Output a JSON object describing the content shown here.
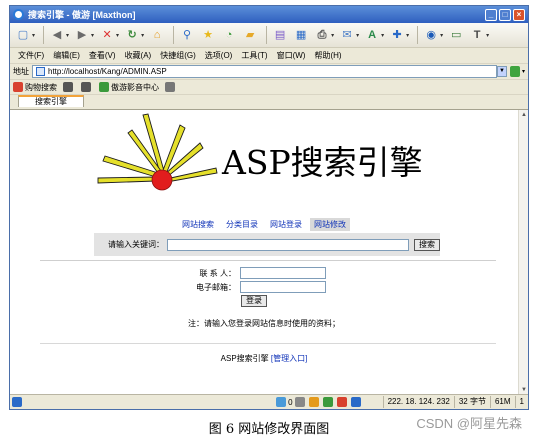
{
  "window": {
    "title": "搜索引擎 - 傲游 [Maxthon]",
    "buttons": {
      "minimize": "_",
      "maximize": "□",
      "close": "×"
    }
  },
  "toolbar": {
    "buttons": [
      {
        "icon": "new-page-icon",
        "glyph": "▢",
        "color": "#4a7ec8"
      },
      {
        "icon": "back-icon",
        "glyph": "◀",
        "color": "#6b6b6b"
      },
      {
        "icon": "forward-icon",
        "glyph": "▶",
        "color": "#6b6b6b"
      },
      {
        "icon": "stop-icon",
        "glyph": "✕",
        "color": "#d33"
      },
      {
        "icon": "refresh-icon",
        "glyph": "↻",
        "color": "#3b8a3b"
      },
      {
        "icon": "home-icon",
        "glyph": "⌂",
        "color": "#e49a1c"
      },
      {
        "icon": "search-icon",
        "glyph": "⚲",
        "color": "#2a6ac8"
      },
      {
        "icon": "favorites-star-icon",
        "glyph": "★",
        "color": "#e8b81a"
      },
      {
        "icon": "history-icon",
        "glyph": "◔",
        "color": "#3b9a3b"
      },
      {
        "icon": "folder-icon",
        "glyph": "▰",
        "color": "#e6a92a"
      },
      {
        "icon": "notes-icon",
        "glyph": "▤",
        "color": "#7a5ac8"
      },
      {
        "icon": "layout-icon",
        "glyph": "▦",
        "color": "#2a6ac8"
      },
      {
        "icon": "print-icon",
        "glyph": "⎙",
        "color": "#555"
      },
      {
        "icon": "mail-icon",
        "glyph": "✉",
        "color": "#4a7ec8"
      },
      {
        "icon": "font-icon",
        "glyph": "A",
        "color": "#2a8a4a"
      },
      {
        "icon": "tools-icon",
        "glyph": "✚",
        "color": "#2a6ac8"
      },
      {
        "icon": "globe-icon",
        "glyph": "◉",
        "color": "#1a5ab8"
      },
      {
        "icon": "screen-icon",
        "glyph": "▭",
        "color": "#3a7a3a"
      },
      {
        "icon": "text-mode-icon",
        "glyph": "T",
        "color": "#4a4a4a"
      }
    ]
  },
  "menubar": {
    "items": [
      "文件(F)",
      "编辑(E)",
      "查看(V)",
      "收藏(A)",
      "快捷组(G)",
      "选项(O)",
      "工具(T)",
      "窗口(W)",
      "帮助(H)"
    ]
  },
  "addressbar": {
    "label": "地址",
    "url": "http://localhost/Kang/ADMIN.ASP"
  },
  "linksbar": {
    "items": [
      {
        "label": "购物搜索",
        "icon": "shopping-icon",
        "color": "#d8412e"
      },
      {
        "label": "",
        "icon": "pen-icon",
        "color": "#555"
      },
      {
        "label": "",
        "icon": "wand-icon",
        "color": "#555"
      },
      {
        "label": "傲游影音中心",
        "icon": "play-icon",
        "color": "#3b9a3b"
      },
      {
        "label": "",
        "icon": "diamond-icon",
        "color": "#777"
      }
    ]
  },
  "tabs": [
    {
      "label": "搜索引擎",
      "active": true
    }
  ],
  "page": {
    "site_title": "ASP搜索引擎",
    "nav": [
      {
        "label": "网站搜索",
        "active": false
      },
      {
        "label": "分类目录",
        "active": false
      },
      {
        "label": "网站登录",
        "active": false
      },
      {
        "label": "网站修改",
        "active": true
      }
    ],
    "search": {
      "label": "请输入关键词：",
      "value": "",
      "button": "搜索"
    },
    "login": {
      "contact_label": "联 系 人：",
      "contact_value": "",
      "email_label": "电子邮箱：",
      "email_value": "",
      "button": "登录"
    },
    "note": "注：请输入您登录网站信息时使用的资料；",
    "footer": {
      "text": "ASP搜索引擎",
      "link": "[管理入口]"
    }
  },
  "statusbar": {
    "ip": "222. 18. 124. 232",
    "bytes": "32 字节",
    "memory": "61M",
    "pages": "1",
    "counter": "0"
  },
  "caption": "图 6  网站修改界面图",
  "watermark": "CSDN @阿星先森",
  "colors": {
    "title_bar": "#3a6fcf",
    "link_blue": "#1033b8",
    "tab_accent": "#f2a33a",
    "logo_sun": "#e11d1d",
    "logo_rays": "#e5e02b"
  }
}
